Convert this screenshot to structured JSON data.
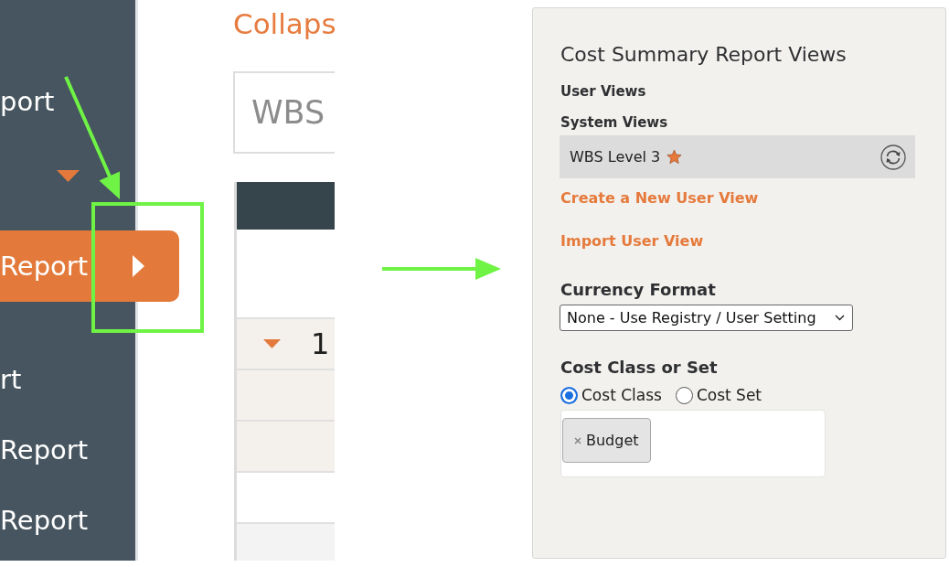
{
  "sidebar": {
    "items": [
      {
        "label": "port",
        "selected": false,
        "expanded": true
      },
      {
        "label": "Report",
        "selected": true,
        "expanded": false
      },
      {
        "label": "rt",
        "selected": false,
        "expanded": false
      },
      {
        "label": "Report",
        "selected": false,
        "expanded": false
      },
      {
        "label": "Report",
        "selected": false,
        "expanded": false
      }
    ]
  },
  "main": {
    "title": "Collaps",
    "filter_field": {
      "placeholder": "WBS"
    },
    "table": {
      "rows": [
        {
          "kind": "group",
          "expanded": true,
          "cells": [
            "1"
          ]
        },
        {
          "kind": "subgroup"
        },
        {
          "kind": "subgroup"
        },
        {
          "kind": "blank"
        },
        {
          "kind": "shaded"
        }
      ]
    }
  },
  "views_panel": {
    "title": "Cost Summary Report Views",
    "user_views_label": "User Views",
    "system_views_label": "System Views",
    "system_views": [
      {
        "name": "WBS Level 3",
        "default": true,
        "selected": true
      }
    ],
    "links": [
      "Create a New User View",
      "Import User View"
    ],
    "currency_format": {
      "label": "Currency Format",
      "value": "None - Use Registry / User Setting"
    },
    "cost_class": {
      "label": "Cost Class or Set",
      "options": [
        {
          "label": "Cost Class",
          "selected": true
        },
        {
          "label": "Cost Set",
          "selected": false
        }
      ],
      "tags": [
        "Budget"
      ]
    }
  }
}
